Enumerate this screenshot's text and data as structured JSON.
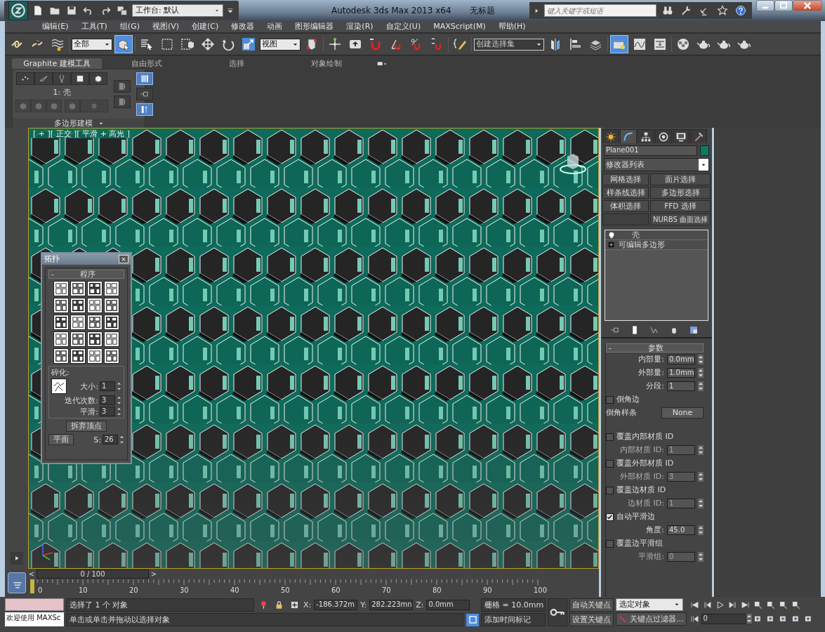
{
  "title_bar": {
    "workspace": "工作台: 默认",
    "title": "Autodesk 3ds Max  2013 x64",
    "document": "无标题",
    "search": {
      "placeholder": "键入关键字或短语"
    }
  },
  "menu": [
    "编辑(E)",
    "工具(T)",
    "组(G)",
    "视图(V)",
    "创建(C)",
    "修改器",
    "动画",
    "图形编辑器",
    "渲染(R)",
    "自定义(U)",
    "MAXScript(M)",
    "帮助(H)"
  ],
  "toolbar": [
    {
      "kind": "icon",
      "selected": false
    },
    {
      "kind": "icon",
      "selected": false
    },
    {
      "kind": "icon",
      "selected": false
    },
    {
      "kind": "dropdown",
      "text": "全部"
    },
    {
      "kind": "icon",
      "selected": true
    },
    {
      "kind": "icon",
      "selected": false
    },
    {
      "kind": "icon",
      "selected": false
    },
    {
      "kind": "icon",
      "selected": false
    },
    {
      "kind": "icon",
      "selected": false
    },
    {
      "kind": "icon",
      "selected": false
    },
    {
      "kind": "icon",
      "selected": false
    },
    {
      "kind": "dropdown",
      "text": "视图"
    },
    {
      "kind": "icon",
      "selected": false
    },
    {
      "kind": "icon",
      "selected": false
    },
    {
      "kind": "icon",
      "selected": false
    },
    {
      "kind": "icon",
      "selected": false
    },
    {
      "kind": "icon",
      "selected": false
    },
    {
      "kind": "icon",
      "selected": false
    },
    {
      "kind": "icon",
      "selected": false
    },
    {
      "kind": "icon",
      "selected": false
    },
    {
      "kind": "dropdown",
      "text": "创建选择集"
    },
    {
      "kind": "icon",
      "selected": false
    },
    {
      "kind": "icon",
      "selected": false
    },
    {
      "kind": "icon",
      "selected": false
    },
    {
      "kind": "icon",
      "selected": true
    },
    {
      "kind": "icon",
      "selected": false
    },
    {
      "kind": "icon",
      "selected": false
    },
    {
      "kind": "icon",
      "selected": false
    },
    {
      "kind": "icon",
      "selected": false
    },
    {
      "kind": "icon",
      "selected": false
    },
    {
      "kind": "icon",
      "selected": false
    }
  ],
  "ribbon": {
    "tabs": [
      {
        "label": "Graphite 建模工具",
        "selected": true
      },
      {
        "label": "自由形式",
        "selected": false
      },
      {
        "label": "选择",
        "selected": false
      },
      {
        "label": "对象绘制",
        "selected": false
      }
    ],
    "level_label": "1: 壳",
    "panel_title": "多边形建模"
  },
  "viewport": {
    "label": "[ + ][ 正交 ][ 平滑 + 高光 ]"
  },
  "topology_dialog": {
    "title": "拓扑",
    "close": "×",
    "rollout": "程序",
    "rollout_toggle": "-",
    "group_label": "碎化:",
    "fields": [
      {
        "label": "大小:",
        "value": "1"
      },
      {
        "label": "迭代次数:",
        "value": "3"
      },
      {
        "label": "平滑:",
        "value": "3"
      }
    ],
    "collapse_button": "拆弃顶点",
    "plane_button": "平面",
    "s_label": "S:",
    "s_value": "26"
  },
  "command_panel": {
    "tabs": [
      {
        "selected": false
      },
      {
        "selected": true
      },
      {
        "selected": false
      },
      {
        "selected": false
      },
      {
        "selected": false
      },
      {
        "selected": false
      }
    ],
    "object_name": "Plane001",
    "modifier_list": "修改器列表",
    "modifier_buttons": [
      {
        "kind": "button",
        "label": "网格选择"
      },
      {
        "kind": "button",
        "label": "面片选择"
      },
      {
        "kind": "button",
        "label": "样条线选择"
      },
      {
        "kind": "button",
        "label": "多边形选择"
      },
      {
        "kind": "button",
        "label": "体积选择"
      },
      {
        "kind": "button",
        "label": "FFD 选择"
      },
      {
        "kind": "blank"
      },
      {
        "kind": "button",
        "label": "NURBS 曲面选择"
      }
    ],
    "stack": [
      {
        "kind": "modifier",
        "label": "壳"
      },
      {
        "kind": "base",
        "label": "可编辑多边形"
      }
    ],
    "params": {
      "title": "参数",
      "toggle": "-",
      "rows": [
        {
          "kind": "spinner",
          "label": "内部量:",
          "value": "0.0mm",
          "disabled": false
        },
        {
          "kind": "spinner",
          "label": "外部量:",
          "value": "1.0mm",
          "disabled": false
        },
        {
          "kind": "spinner",
          "label": "分段:",
          "value": "1",
          "disabled": false
        },
        {
          "kind": "checkbox",
          "label": "倒角边",
          "checked": false
        },
        {
          "kind": "button",
          "label": "倒角样条",
          "value": "None"
        },
        {
          "kind": "gap"
        },
        {
          "kind": "checkbox",
          "label": "覆盖内部材质 ID",
          "checked": false
        },
        {
          "kind": "spinner",
          "label": "内部材质 ID:",
          "value": "1",
          "disabled": true
        },
        {
          "kind": "checkbox",
          "label": "覆盖外部材质 ID",
          "checked": false
        },
        {
          "kind": "spinner",
          "label": "外部材质 ID:",
          "value": "3",
          "disabled": true
        },
        {
          "kind": "checkbox",
          "label": "覆盖边材质 ID",
          "checked": false
        },
        {
          "kind": "spinner",
          "label": "边材质 ID:",
          "value": "1",
          "disabled": true
        },
        {
          "kind": "checkbox",
          "label": "自动平滑边",
          "checked": true
        },
        {
          "kind": "spinner",
          "label": "角度:",
          "value": "45.0",
          "disabled": false
        },
        {
          "kind": "checkbox",
          "label": "覆盖边平滑组",
          "checked": false
        },
        {
          "kind": "spinner",
          "label": "平滑组:",
          "value": "0",
          "disabled": true
        }
      ]
    }
  },
  "timeline": {
    "prev": "<",
    "position": "0 / 100",
    "next": ">",
    "ticks": [
      "0",
      "10",
      "20",
      "30",
      "40",
      "50",
      "60",
      "70",
      "80",
      "90",
      "100"
    ]
  },
  "status": {
    "welcome": "欢迎使用 MAXSc",
    "selection": "选择了 1 个 对象",
    "prompt": "单击或单击并拖动以选择对象",
    "x_label": "X:",
    "x": "-186.372m",
    "y_label": "Y:",
    "y": "282.223mn",
    "z_label": "Z:",
    "z": "0.0mm",
    "grid": "栅格 = 10.0mm",
    "add_tag": "添加时间标记",
    "auto_key": "自动关键点",
    "set_key": "设置关键点",
    "key_mode": "选定对象",
    "key_filters": "关键点过滤器...",
    "frame": "0"
  }
}
